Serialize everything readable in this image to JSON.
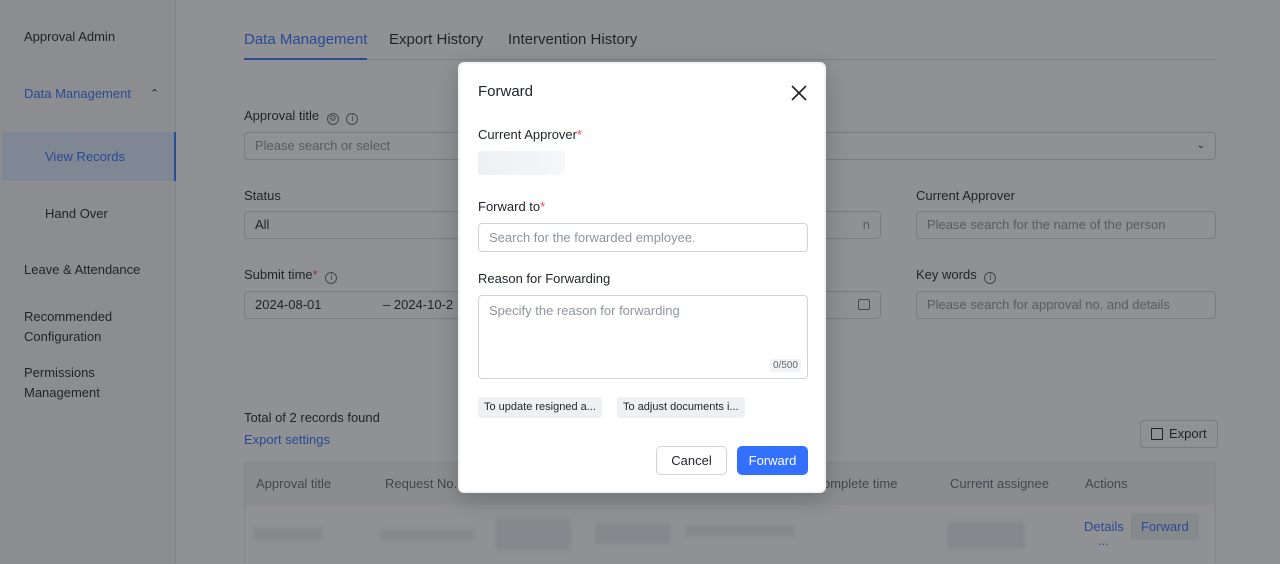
{
  "sidebar": {
    "items": [
      {
        "label": "Approval Admin"
      },
      {
        "label": "Data Management"
      },
      {
        "label": "View Records"
      },
      {
        "label": "Hand Over"
      },
      {
        "label": "Leave & Attendance"
      },
      {
        "label": "Recommended Configuration"
      },
      {
        "label": "Permissions Management"
      }
    ]
  },
  "tabs": [
    "Data Management",
    "Export History",
    "Intervention History"
  ],
  "filters": {
    "approval_title_label": "Approval title",
    "approval_title_placeholder": "Please search or select",
    "status_label": "Status",
    "status_value": "All",
    "current_approver_label": "Current Approver",
    "current_approver_placeholder": "Please search for the name of the person",
    "partial_field_text": "n",
    "submit_time_label": "Submit time",
    "submit_from": "2024-08-01",
    "submit_to": "– 2024-10-2",
    "keywords_label": "Key words",
    "keywords_placeholder": "Please search for approval no. and details"
  },
  "results": {
    "total_text": "Total of 2 records found",
    "export_settings": "Export settings",
    "export_button": "Export"
  },
  "table": {
    "headers": [
      "Approval title",
      "Request No.",
      "omplete time",
      "Current assignee",
      "Actions"
    ],
    "row_actions": {
      "details": "Details",
      "more": "...",
      "forward": "Forward"
    }
  },
  "modal": {
    "title": "Forward",
    "current_approver_label": "Current Approver",
    "forward_to_label": "Forward to",
    "forward_to_placeholder": "Search for the forwarded employee.",
    "reason_label": "Reason for Forwarding",
    "reason_placeholder": "Specify the reason for forwarding",
    "reason_count": "0/500",
    "chips": [
      "To update resigned a...",
      "To adjust documents i..."
    ],
    "cancel": "Cancel",
    "forward": "Forward",
    "required_mark": "*"
  },
  "colors": {
    "accent": "#3370ff",
    "required": "#f54a45"
  }
}
